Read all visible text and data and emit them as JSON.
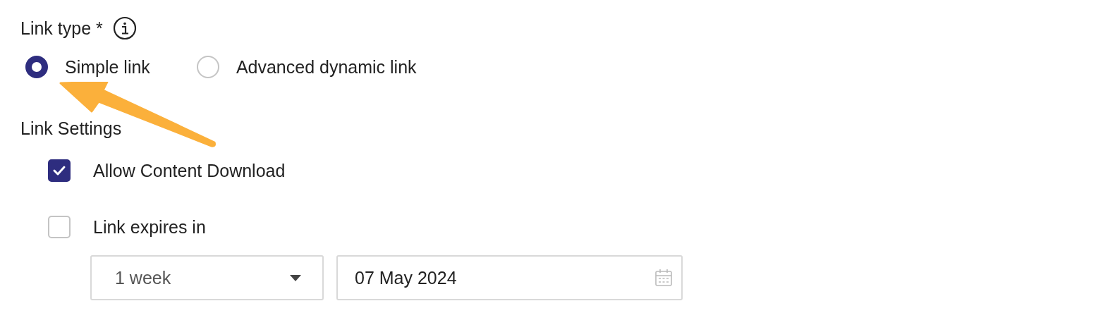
{
  "link_type": {
    "label": "Link type *",
    "options": [
      {
        "label": "Simple link",
        "selected": true
      },
      {
        "label": "Advanced dynamic link",
        "selected": false
      }
    ]
  },
  "link_settings": {
    "label": "Link Settings",
    "options": [
      {
        "label": "Allow Content Download",
        "checked": true
      },
      {
        "label": "Link expires in",
        "checked": false
      }
    ]
  },
  "expiry": {
    "duration": "1 week",
    "date": "07 May 2024"
  }
}
